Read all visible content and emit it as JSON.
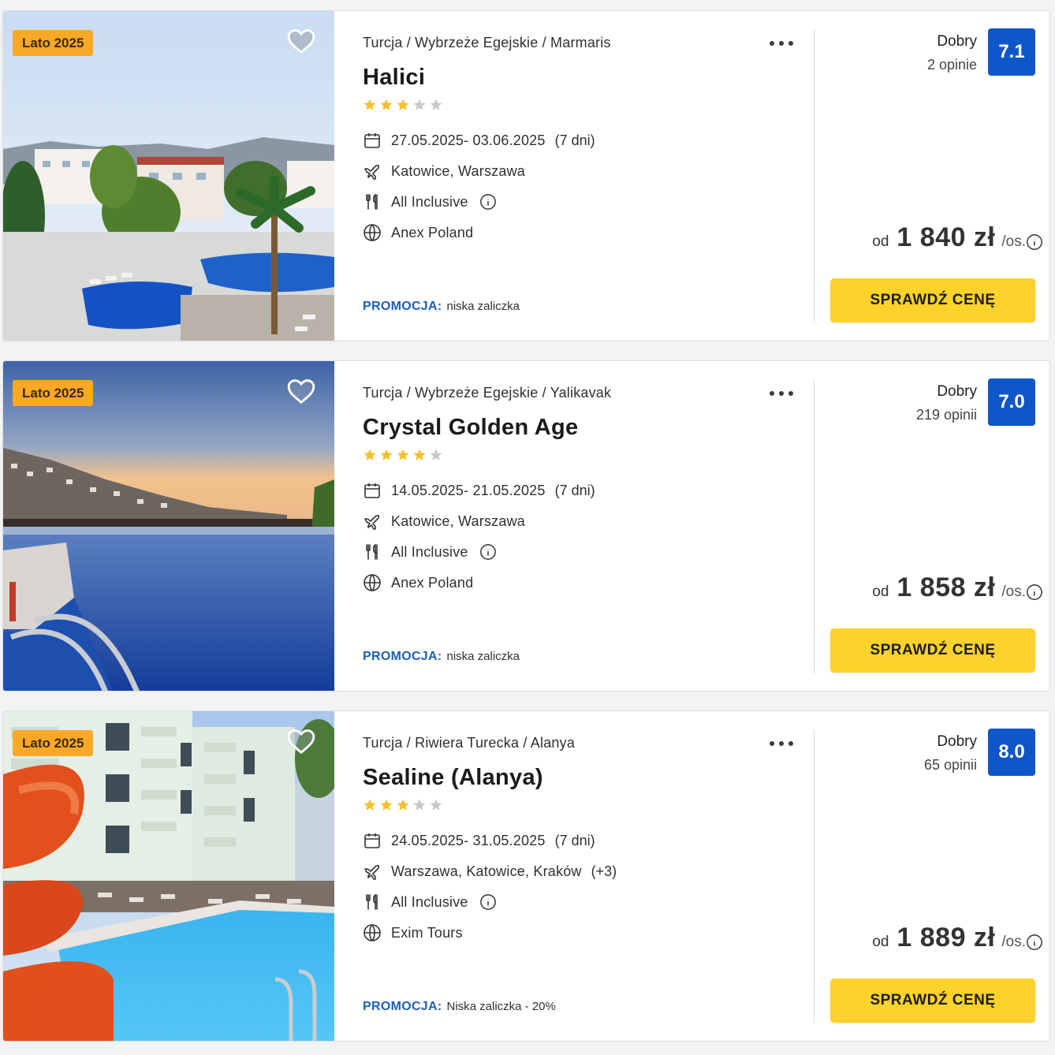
{
  "colors": {
    "badge": "#f9a828",
    "score": "#0f57c8",
    "cta": "#fdd22a",
    "promo_label": "#1d5fb8",
    "star_on": "#f6c02b",
    "star_off": "#c9c9c9"
  },
  "offers": [
    {
      "season_badge": "Lato 2025",
      "breadcrumb": "Turcja / Wybrzeże Egejskie / Marmaris",
      "name": "Halici",
      "stars": 3,
      "dates": "27.05.2025- 03.06.2025",
      "duration": "(7 dni)",
      "airports": "Katowice, Warszawa",
      "airports_more": "",
      "board": "All Inclusive",
      "operator": "Anex Poland",
      "promo_label": "PROMOCJA:",
      "promo_text": "niska zaliczka",
      "rating_word": "Dobry",
      "rating_count": "2 opinie",
      "rating_score": "7.1",
      "price_prefix": "od",
      "price": "1 840 zł",
      "price_suffix": "/os.",
      "cta_label": "SPRAWDŹ CENĘ"
    },
    {
      "season_badge": "Lato 2025",
      "breadcrumb": "Turcja / Wybrzeże Egejskie / Yalikavak",
      "name": "Crystal Golden Age",
      "stars": 4,
      "dates": "14.05.2025- 21.05.2025",
      "duration": "(7 dni)",
      "airports": "Katowice, Warszawa",
      "airports_more": "",
      "board": "All Inclusive",
      "operator": "Anex Poland",
      "promo_label": "PROMOCJA:",
      "promo_text": "niska zaliczka",
      "rating_word": "Dobry",
      "rating_count": "219 opinii",
      "rating_score": "7.0",
      "price_prefix": "od",
      "price": "1 858 zł",
      "price_suffix": "/os.",
      "cta_label": "SPRAWDŹ CENĘ"
    },
    {
      "season_badge": "Lato 2025",
      "breadcrumb": "Turcja / Riwiera Turecka / Alanya",
      "name": "Sealine (Alanya)",
      "stars": 3,
      "dates": "24.05.2025- 31.05.2025",
      "duration": "(7 dni)",
      "airports": "Warszawa, Katowice, Kraków",
      "airports_more": "(+3)",
      "board": "All Inclusive",
      "operator": "Exim Tours",
      "promo_label": "PROMOCJA:",
      "promo_text": "Niska zaliczka - 20%",
      "rating_word": "Dobry",
      "rating_count": "65 opinii",
      "rating_score": "8.0",
      "price_prefix": "od",
      "price": "1 889 zł",
      "price_suffix": "/os.",
      "cta_label": "SPRAWDŹ CENĘ"
    }
  ]
}
